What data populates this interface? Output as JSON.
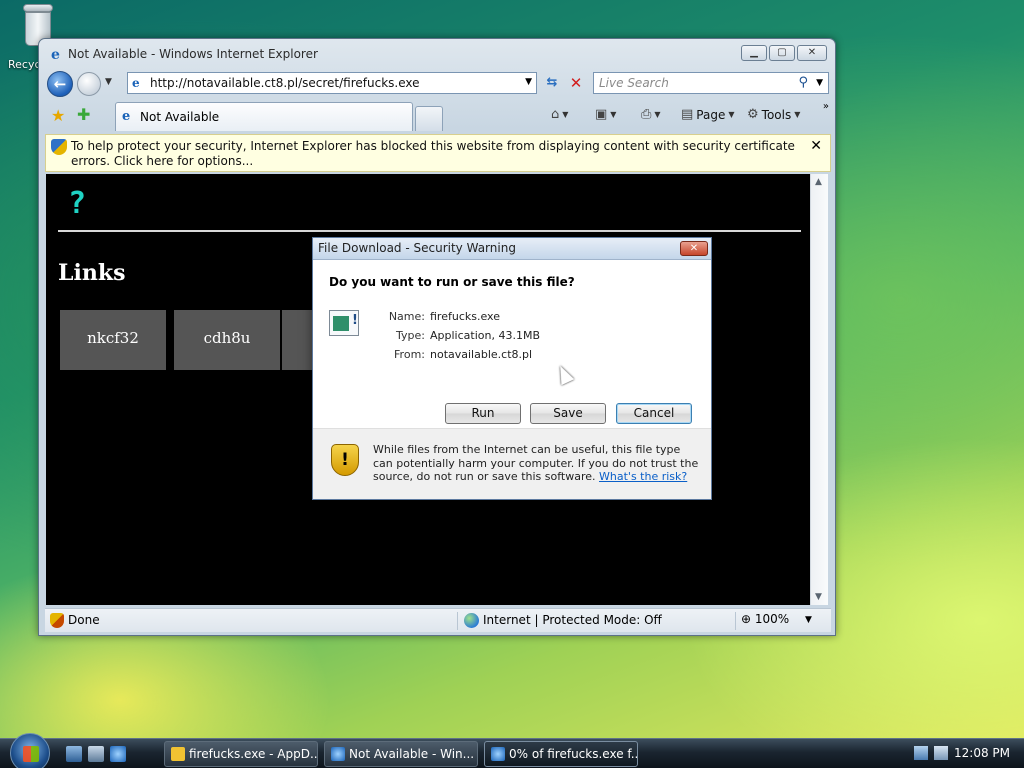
{
  "desktop": {
    "recycle_bin_label": "Recyc"
  },
  "browser": {
    "window_title": "Not Available - Windows Internet Explorer",
    "address_url": "http://notavailable.ct8.pl/secret/firefucks.exe",
    "search_placeholder": "Live Search",
    "tab_label": "Not Available",
    "commands": {
      "page_label": "Page",
      "tools_label": "Tools"
    },
    "infobar_message": "To help protect your security, Internet Explorer has blocked this website from displaying content with security certificate errors. Click here for options...",
    "status": {
      "text": "Done",
      "zone": "Internet | Protected Mode: Off",
      "zoom": "100%"
    }
  },
  "page": {
    "heading": "Links",
    "tiles": [
      "nkcf32",
      "cdh8u"
    ]
  },
  "dialog": {
    "title": "File Download - Security Warning",
    "question": "Do you want to run or save this file?",
    "fields": [
      {
        "label": "Name:",
        "value": "firefucks.exe"
      },
      {
        "label": "Type:",
        "value": "Application, 43.1MB"
      },
      {
        "label": "From:",
        "value": "notavailable.ct8.pl"
      }
    ],
    "buttons": {
      "run": "Run",
      "save": "Save",
      "cancel": "Cancel"
    },
    "warning_text": "While files from the Internet can be useful, this file type can potentially harm your computer. If you do not trust the source, do not run or save this software.",
    "warning_link": "What's the risk?"
  },
  "taskbar": {
    "tasks": [
      "firefucks.exe - AppD...",
      "Not Available - Win...",
      "0% of firefucks.exe f..."
    ],
    "clock": "12:08 PM"
  },
  "colors": {
    "page_background": "#000000",
    "tile_background": "#555555",
    "logo_cyan": "#1fd3c4",
    "infobar_background": "#ffffe1",
    "link_blue": "#0a5fc8"
  }
}
